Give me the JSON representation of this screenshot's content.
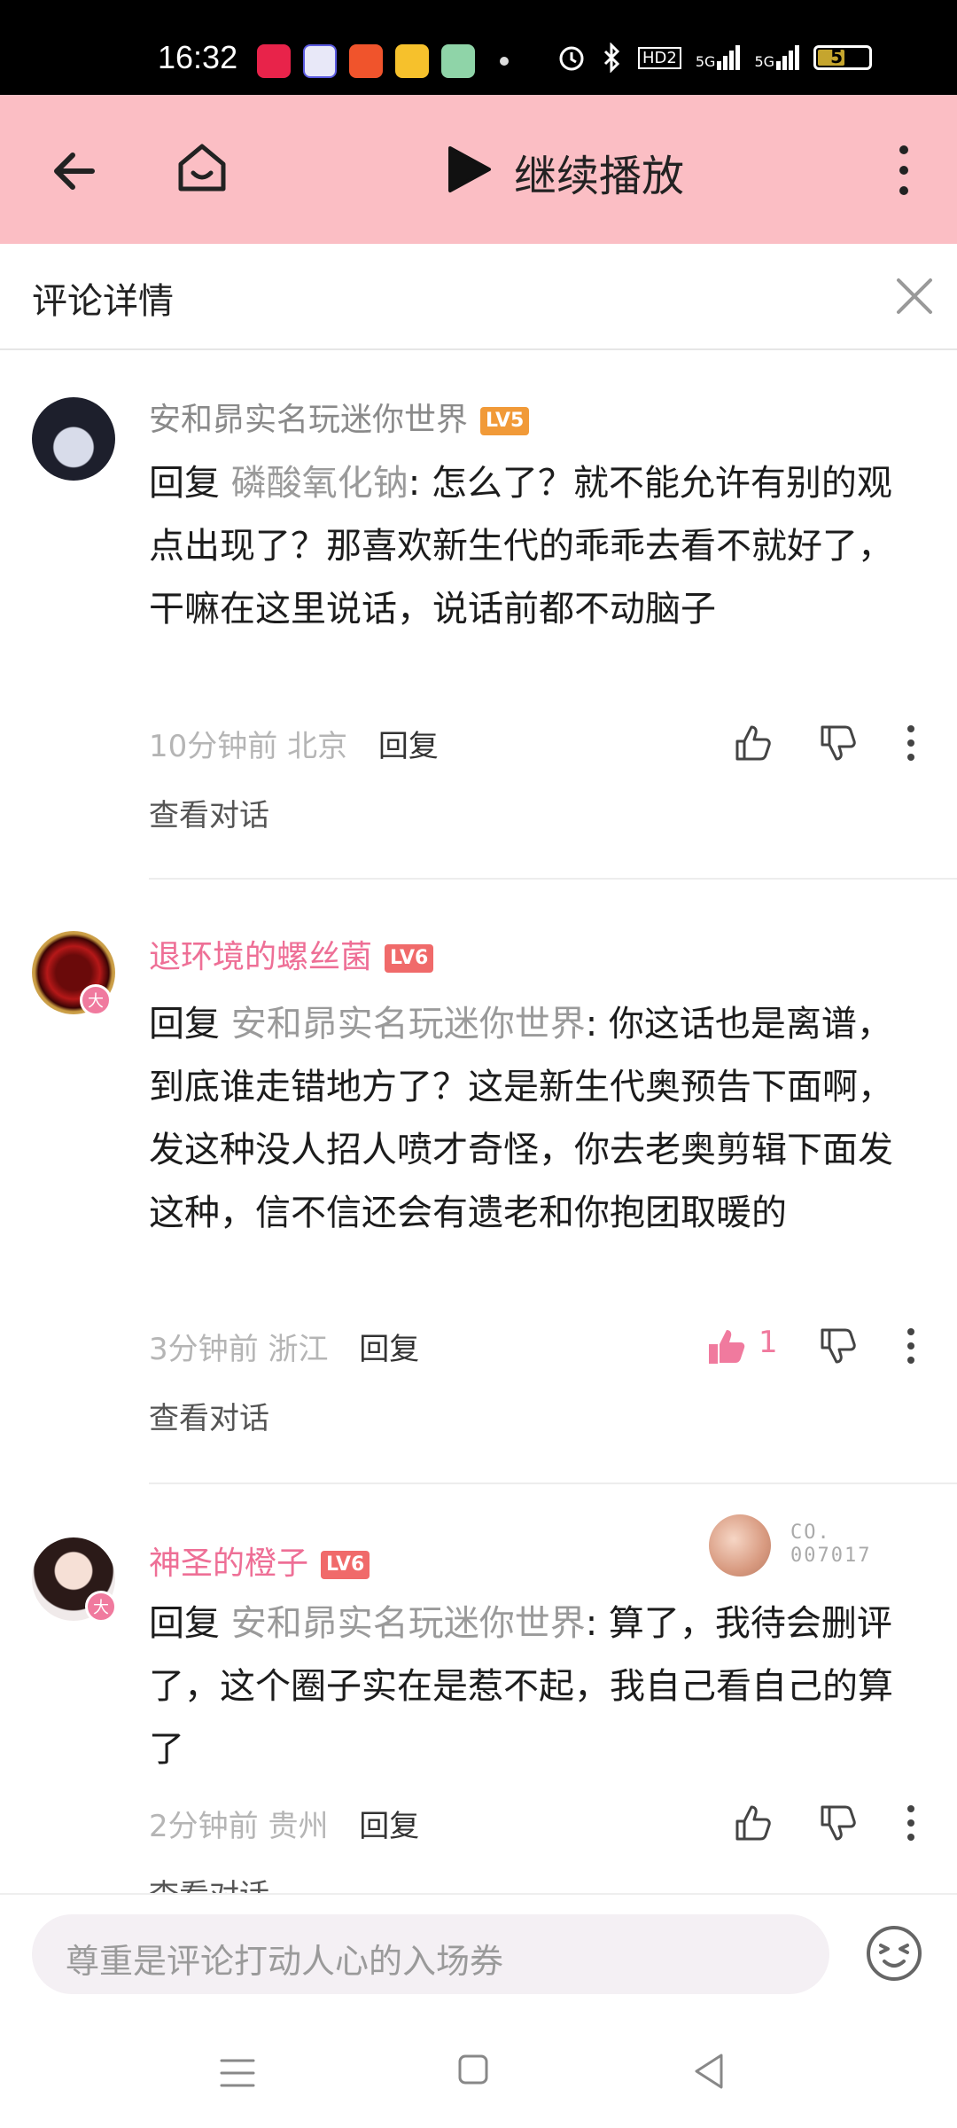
{
  "status_bar": {
    "time": "16:32",
    "signal_label_1": "5G",
    "signal_label_2": "5G",
    "hd_label": "HD2",
    "battery": "51"
  },
  "top_nav": {
    "continue_label": "继续播放"
  },
  "section": {
    "title": "评论详情"
  },
  "comments": [
    {
      "username": "安和昴实名玩迷你世界",
      "level": "LV5",
      "reply_prefix": "回复 ",
      "reply_to": "磷酸氧化钠",
      "text": ": 怎么了？就不能允许有别的观点出现了？那喜欢新生代的乖乖去看不就好了，干嘛在这里说话，说话前都不动脑子",
      "time": "10分钟前",
      "location": "北京",
      "reply_label": "回复",
      "likes": "",
      "view_conversation": "查看对话"
    },
    {
      "username": "退环境的螺丝菌",
      "level": "LV6",
      "reply_prefix": "回复 ",
      "reply_to": "安和昴实名玩迷你世界",
      "text": ": 你这话也是离谱，到底谁走错地方了？这是新生代奥预告下面啊，发这种没人招人喷才奇怪，你去老奥剪辑下面发这种，信不信还会有遗老和你抱团取暖的",
      "time": "3分钟前",
      "location": "浙江",
      "reply_label": "回复",
      "likes": "1",
      "view_conversation": "查看对话"
    },
    {
      "username": "神圣的橙子",
      "level": "LV6",
      "reply_prefix": "回复 ",
      "reply_to": "安和昴实名玩迷你世界",
      "text": ": 算了，我待会删评了，这个圈子实在是惹不起，我自己看自己的算了",
      "time": "2分钟前",
      "location": "贵州",
      "reply_label": "回复",
      "likes": "",
      "view_conversation": "查看对话",
      "medal_text_line1": "CO.",
      "medal_text_line2": "007017"
    }
  ],
  "bottom_bar": {
    "placeholder": "尊重是评论打动人心的入场券"
  },
  "colors": {
    "nav_bg": "#fbbec4",
    "accent_pink": "#f07a9e",
    "lv_orange": "#f19a38",
    "lv_red": "#f06a6a"
  }
}
